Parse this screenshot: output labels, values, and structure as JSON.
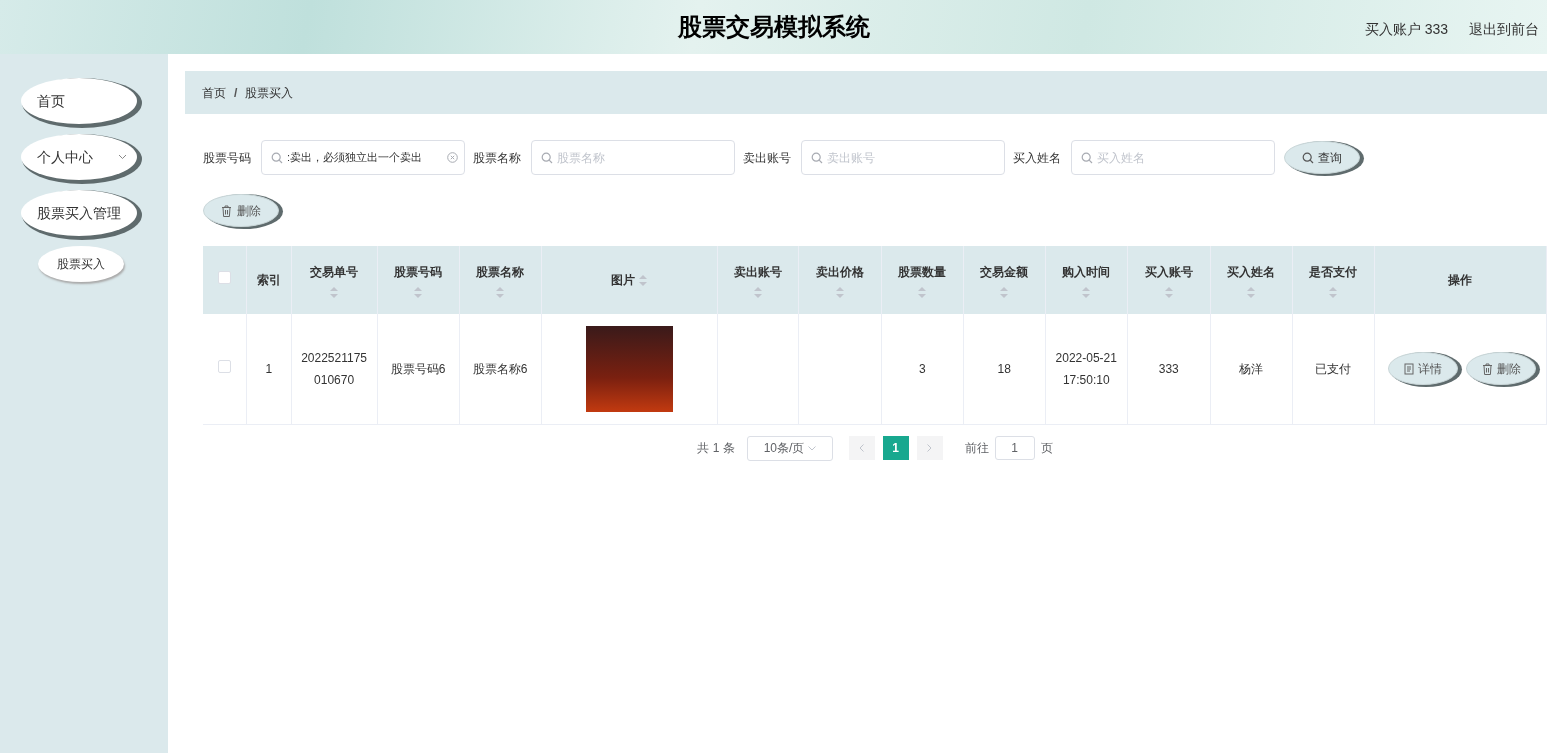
{
  "header": {
    "title": "股票交易模拟系统",
    "account": "买入账户 333",
    "logout": "退出到前台"
  },
  "sidebar": {
    "items": [
      {
        "label": "首页",
        "kind": "link"
      },
      {
        "label": "个人中心",
        "kind": "dropdown"
      },
      {
        "label": "股票买入管理",
        "kind": "link",
        "children": [
          {
            "label": "股票买入"
          }
        ]
      }
    ]
  },
  "breadcrumb": [
    "首页",
    "股票买入"
  ],
  "breadcrumb_separator": "/",
  "filters": [
    {
      "label": "股票号码",
      "value": ":卖出，必须独立出一个卖出"
    },
    {
      "label": "股票名称",
      "placeholder": "股票名称"
    },
    {
      "label": "卖出账号",
      "placeholder": "卖出账号"
    },
    {
      "label": "买入姓名",
      "placeholder": "买入姓名"
    }
  ],
  "search_button": "查询",
  "delete_button": "删除",
  "table": {
    "all_checked": false,
    "columns": [
      {
        "label": "索引",
        "sortable": false
      },
      {
        "label": "交易单号",
        "sortable": true
      },
      {
        "label": "股票号码",
        "sortable": true
      },
      {
        "label": "股票名称",
        "sortable": true
      },
      {
        "label": "图片",
        "sortable": true
      },
      {
        "label": "卖出账号",
        "sortable": true
      },
      {
        "label": "卖出价格",
        "sortable": true
      },
      {
        "label": "股票数量",
        "sortable": true
      },
      {
        "label": "交易金额",
        "sortable": true
      },
      {
        "label": "购入时间",
        "sortable": true
      },
      {
        "label": "买入账号",
        "sortable": true
      },
      {
        "label": "买入姓名",
        "sortable": true
      },
      {
        "label": "是否支付",
        "sortable": true
      },
      {
        "label": "操作",
        "sortable": false
      }
    ],
    "rows": [
      {
        "checked": false,
        "cells": [
          {
            "kind": "text",
            "text": "1"
          },
          {
            "kind": "text",
            "text": "2022521175010670"
          },
          {
            "kind": "text",
            "text": "股票号码6"
          },
          {
            "kind": "text",
            "text": "股票名称6"
          },
          {
            "kind": "image"
          },
          {
            "kind": "empty"
          },
          {
            "kind": "empty"
          },
          {
            "kind": "text",
            "text": "3"
          },
          {
            "kind": "text",
            "text": "18"
          },
          {
            "kind": "text",
            "text": "2022-05-21 17:50:10"
          },
          {
            "kind": "text",
            "text": "333"
          },
          {
            "kind": "text",
            "text": "杨洋"
          },
          {
            "kind": "text",
            "text": "已支付"
          },
          {
            "kind": "actions",
            "buttons": [
              {
                "kind": "detail",
                "label": "详情"
              },
              {
                "kind": "delete",
                "label": "删除"
              }
            ]
          }
        ]
      }
    ]
  },
  "pagination": {
    "total": "共 1 条",
    "page_size": "10条/页",
    "pages": [
      {
        "label": "1",
        "selected": true
      }
    ],
    "goto_label": "前往",
    "goto_value": "1",
    "goto_suffix": "页"
  }
}
